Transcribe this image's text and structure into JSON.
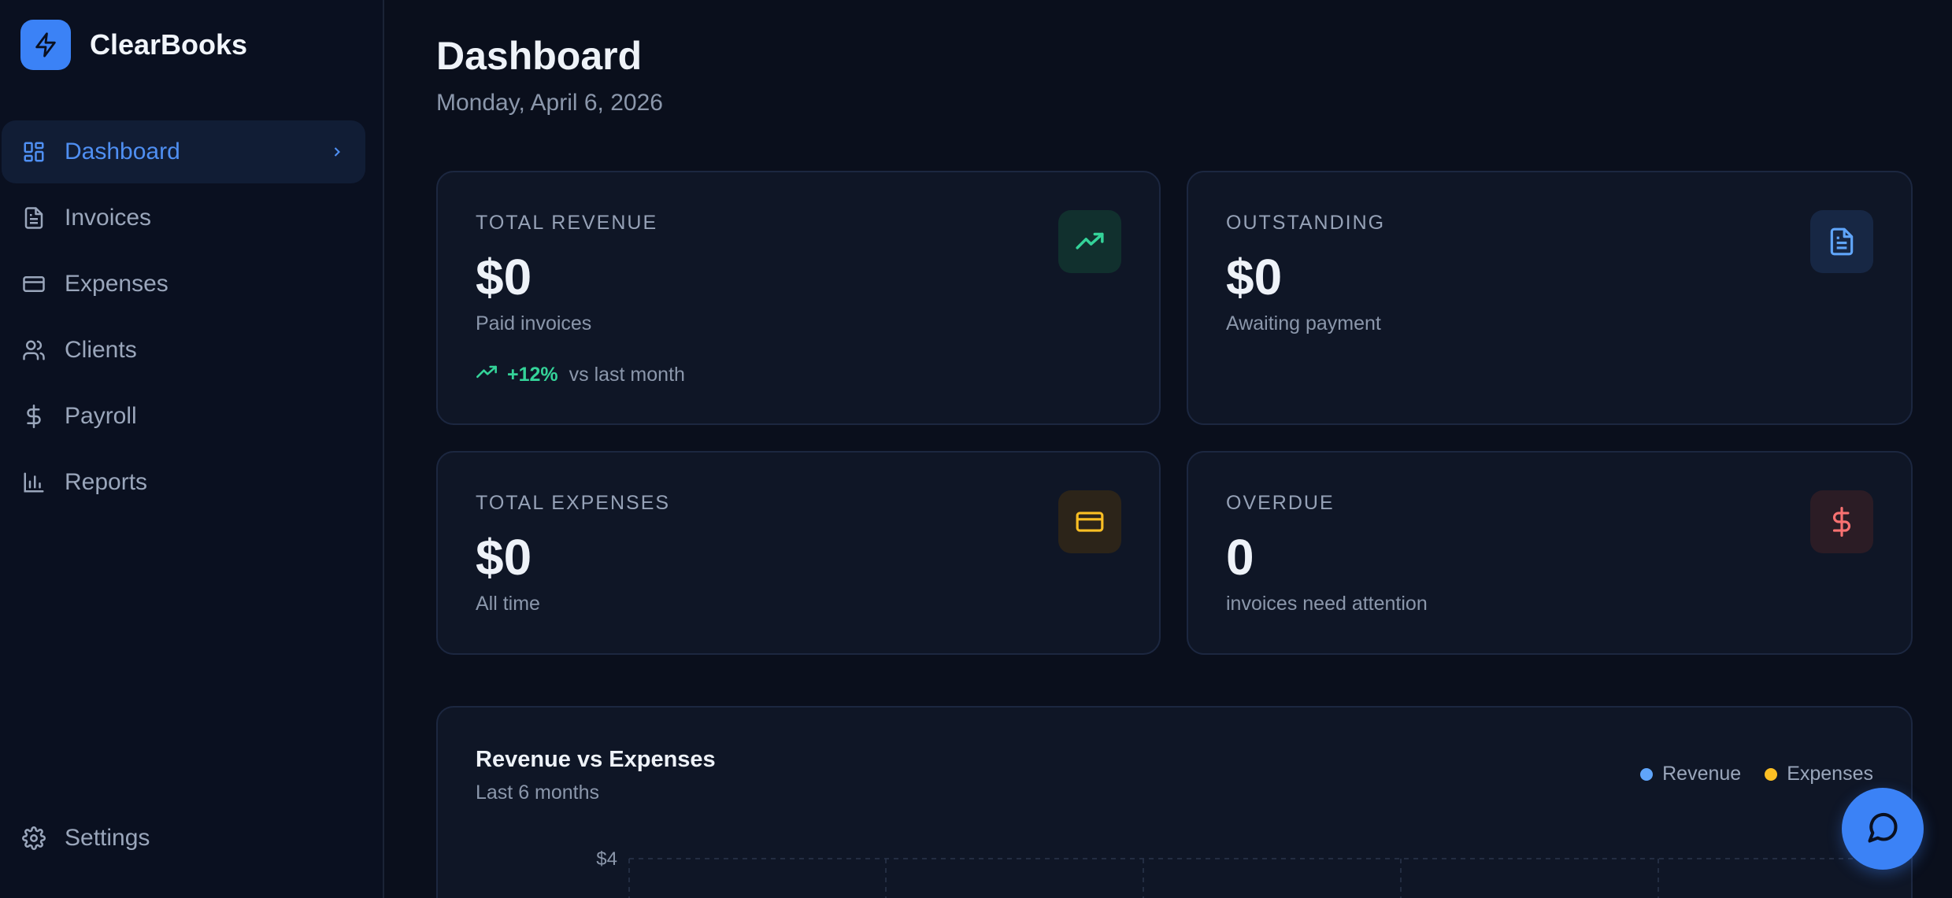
{
  "brand": {
    "name": "ClearBooks"
  },
  "nav": [
    {
      "label": "Dashboard",
      "icon": "dashboard-icon",
      "active": true
    },
    {
      "label": "Invoices",
      "icon": "file-text-icon"
    },
    {
      "label": "Expenses",
      "icon": "credit-card-icon"
    },
    {
      "label": "Clients",
      "icon": "users-icon"
    },
    {
      "label": "Payroll",
      "icon": "dollar-icon"
    },
    {
      "label": "Reports",
      "icon": "bar-chart-icon"
    }
  ],
  "settings": {
    "label": "Settings",
    "icon": "gear-icon"
  },
  "header": {
    "title": "Dashboard",
    "date": "Monday, April 6, 2026"
  },
  "cards": {
    "revenue": {
      "label": "TOTAL REVENUE",
      "value": "$0",
      "sub": "Paid invoices",
      "trend_pct": "+12%",
      "trend_text": "vs last month",
      "icon": "trending-up-icon",
      "color": "#34d399"
    },
    "outstanding": {
      "label": "OUTSTANDING",
      "value": "$0",
      "sub": "Awaiting payment",
      "icon": "file-text-icon",
      "color": "#60a5fa"
    },
    "expenses": {
      "label": "TOTAL EXPENSES",
      "value": "$0",
      "sub": "All time",
      "icon": "credit-card-icon",
      "color": "#fbbf24"
    },
    "overdue": {
      "label": "OVERDUE",
      "value": "0",
      "sub": "invoices need attention",
      "icon": "dollar-icon",
      "color": "#f87171"
    }
  },
  "chart": {
    "title": "Revenue vs Expenses",
    "subtitle": "Last 6 months",
    "legend": [
      {
        "name": "Revenue",
        "color": "#60a5fa"
      },
      {
        "name": "Expenses",
        "color": "#fbbf24"
      }
    ],
    "y_top_label": "$4"
  },
  "chart_data": {
    "type": "area",
    "title": "Revenue vs Expenses",
    "subtitle": "Last 6 months",
    "ytick_labels": [
      "$4"
    ],
    "series": [
      {
        "name": "Revenue",
        "color": "#60a5fa"
      },
      {
        "name": "Expenses",
        "color": "#fbbf24"
      }
    ],
    "grid": true
  },
  "fab": {
    "icon": "chat-icon"
  }
}
